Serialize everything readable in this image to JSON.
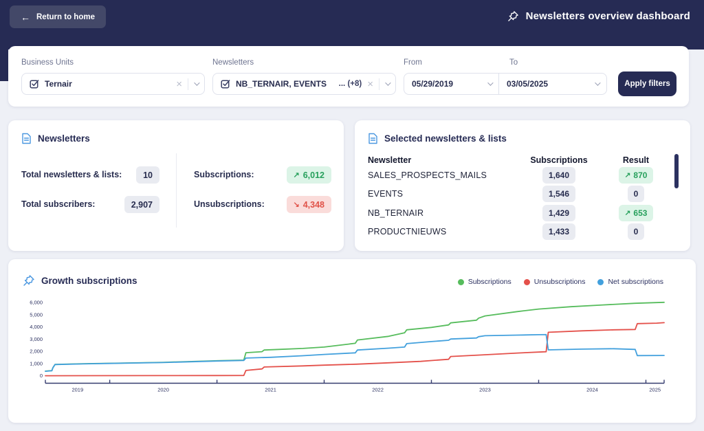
{
  "topbar": {
    "back_label": "Return to home",
    "back_arrow": "←",
    "title": "Newsletters overview dashboard"
  },
  "filters": {
    "business_units": {
      "label": "Business Units",
      "value": "Ternair",
      "clear": "×"
    },
    "newsletters": {
      "label": "Newsletters",
      "value": "NB_TERNAIR, EVENTS",
      "more": "... (+8)",
      "clear": "×"
    },
    "from": {
      "label": "From",
      "value": "05/29/2019"
    },
    "to": {
      "label": "To",
      "value": "03/05/2025"
    },
    "apply_label": "Apply filters"
  },
  "newsletters_card": {
    "title": "Newsletters",
    "stats": [
      {
        "label": "Total newsletters & lists:",
        "value": "10",
        "arrow": "",
        "tone": "neutral"
      },
      {
        "label": "Total subscribers:",
        "value": "2,907",
        "arrow": "",
        "tone": "neutral"
      },
      {
        "label": "Subscriptions:",
        "value": "6,012",
        "arrow": "↗",
        "tone": "positive"
      },
      {
        "label": "Unsubscriptions:",
        "value": "4,348",
        "arrow": "↘",
        "tone": "negative"
      }
    ]
  },
  "selected_card": {
    "title": "Selected newsletters & lists",
    "columns": {
      "name": "Newsletter",
      "subscriptions": "Subscriptions",
      "result": "Result"
    },
    "rows": [
      {
        "name": "SALES_PROSPECTS_MAILS",
        "subscriptions": "1,640",
        "result": "870",
        "arrow": "↗",
        "tone": "positive"
      },
      {
        "name": "EVENTS",
        "subscriptions": "1,546",
        "result": "0",
        "arrow": "",
        "tone": "neutral"
      },
      {
        "name": "NB_TERNAIR",
        "subscriptions": "1,429",
        "result": "653",
        "arrow": "↗",
        "tone": "positive"
      },
      {
        "name": "PRODUCTNIEUWS",
        "subscriptions": "1,433",
        "result": "0",
        "arrow": "",
        "tone": "neutral"
      }
    ]
  },
  "chart_data": {
    "type": "line",
    "title": "Growth subscriptions",
    "x_range": [
      2019.4,
      2025.17
    ],
    "ylim": [
      0,
      6000
    ],
    "y_ticks": [
      0,
      1000,
      2000,
      3000,
      4000,
      5000,
      6000
    ],
    "x_ticks": [
      "2019",
      "2020",
      "2021",
      "2022",
      "2023",
      "2024",
      "2025"
    ],
    "grid": false,
    "legend_position": "top-right",
    "axis_color": "#353b6e",
    "series": [
      {
        "name": "Subscriptions",
        "color": "#56bc5c",
        "points": [
          [
            2019.4,
            380
          ],
          [
            2019.46,
            420
          ],
          [
            2019.47,
            660
          ],
          [
            2019.49,
            930
          ],
          [
            2019.75,
            990
          ],
          [
            2020.0,
            1025
          ],
          [
            2020.5,
            1100
          ],
          [
            2021.0,
            1230
          ],
          [
            2021.25,
            1280
          ],
          [
            2021.27,
            1890
          ],
          [
            2021.42,
            1975
          ],
          [
            2021.44,
            2110
          ],
          [
            2021.8,
            2240
          ],
          [
            2022.0,
            2350
          ],
          [
            2022.29,
            2660
          ],
          [
            2022.31,
            2930
          ],
          [
            2022.6,
            3230
          ],
          [
            2022.75,
            3520
          ],
          [
            2022.77,
            3760
          ],
          [
            2023.0,
            3960
          ],
          [
            2023.16,
            4160
          ],
          [
            2023.18,
            4330
          ],
          [
            2023.42,
            4550
          ],
          [
            2023.44,
            4720
          ],
          [
            2023.5,
            4900
          ],
          [
            2023.8,
            5250
          ],
          [
            2024.0,
            5460
          ],
          [
            2024.3,
            5650
          ],
          [
            2024.6,
            5800
          ],
          [
            2024.9,
            5930
          ],
          [
            2025.17,
            6012
          ]
        ]
      },
      {
        "name": "Unsubscriptions",
        "color": "#e4504a",
        "points": [
          [
            2019.4,
            8
          ],
          [
            2020.5,
            18
          ],
          [
            2021.0,
            22
          ],
          [
            2021.25,
            28
          ],
          [
            2021.27,
            440
          ],
          [
            2021.42,
            560
          ],
          [
            2021.44,
            720
          ],
          [
            2021.8,
            810
          ],
          [
            2022.0,
            870
          ],
          [
            2022.3,
            950
          ],
          [
            2022.6,
            1060
          ],
          [
            2022.9,
            1180
          ],
          [
            2023.0,
            1250
          ],
          [
            2023.16,
            1350
          ],
          [
            2023.18,
            1580
          ],
          [
            2023.45,
            1700
          ],
          [
            2023.8,
            1860
          ],
          [
            2024.05,
            1960
          ],
          [
            2024.07,
            1966
          ],
          [
            2024.09,
            3560
          ],
          [
            2024.4,
            3680
          ],
          [
            2024.7,
            3760
          ],
          [
            2024.9,
            3790
          ],
          [
            2024.92,
            4270
          ],
          [
            2025.1,
            4310
          ],
          [
            2025.17,
            4348
          ]
        ]
      },
      {
        "name": "Net subscriptions",
        "color": "#42a0dd",
        "points": [
          [
            2019.4,
            372
          ],
          [
            2019.46,
            412
          ],
          [
            2019.47,
            650
          ],
          [
            2019.49,
            920
          ],
          [
            2019.75,
            975
          ],
          [
            2020.0,
            1010
          ],
          [
            2020.5,
            1085
          ],
          [
            2021.0,
            1210
          ],
          [
            2021.25,
            1255
          ],
          [
            2021.27,
            1450
          ],
          [
            2021.5,
            1510
          ],
          [
            2021.8,
            1640
          ],
          [
            2022.0,
            1750
          ],
          [
            2022.29,
            1880
          ],
          [
            2022.31,
            2110
          ],
          [
            2022.6,
            2260
          ],
          [
            2022.75,
            2350
          ],
          [
            2022.77,
            2630
          ],
          [
            2023.0,
            2800
          ],
          [
            2023.16,
            2910
          ],
          [
            2023.18,
            3010
          ],
          [
            2023.42,
            3090
          ],
          [
            2023.44,
            3200
          ],
          [
            2023.5,
            3280
          ],
          [
            2023.8,
            3330
          ],
          [
            2024.0,
            3360
          ],
          [
            2024.07,
            3371
          ],
          [
            2024.09,
            2120
          ],
          [
            2024.4,
            2180
          ],
          [
            2024.7,
            2215
          ],
          [
            2024.9,
            2160
          ],
          [
            2024.92,
            1655
          ],
          [
            2025.17,
            1664
          ]
        ]
      }
    ]
  }
}
